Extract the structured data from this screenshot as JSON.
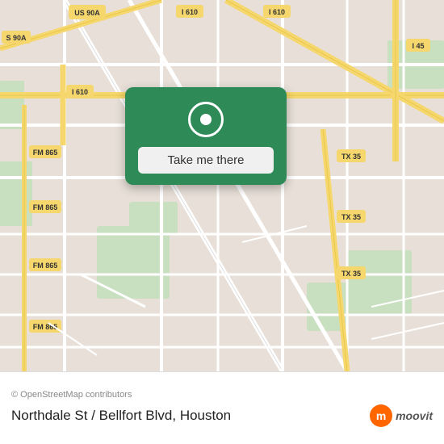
{
  "map": {
    "background_color": "#e8e0d8",
    "road_color": "#ffffff",
    "highway_color": "#f5d76e",
    "highway_label_bg": "#f5d76e",
    "green_area_color": "#c8dfc0"
  },
  "card": {
    "background_color": "#2e8b57",
    "button_label": "Take me there",
    "button_bg": "#f0f0f0"
  },
  "highway_labels": [
    "US 90A",
    "S 90A",
    "I 610",
    "I 610",
    "I 610",
    "I 45",
    "FM 865",
    "FM 865",
    "FM 865",
    "FM 865",
    "TX 35",
    "TX 35",
    "TX 35"
  ],
  "bottom_bar": {
    "attribution": "© OpenStreetMap contributors",
    "location_name": "Northdale St / Bellfort Blvd, Houston",
    "moovit_label": "moovit"
  }
}
